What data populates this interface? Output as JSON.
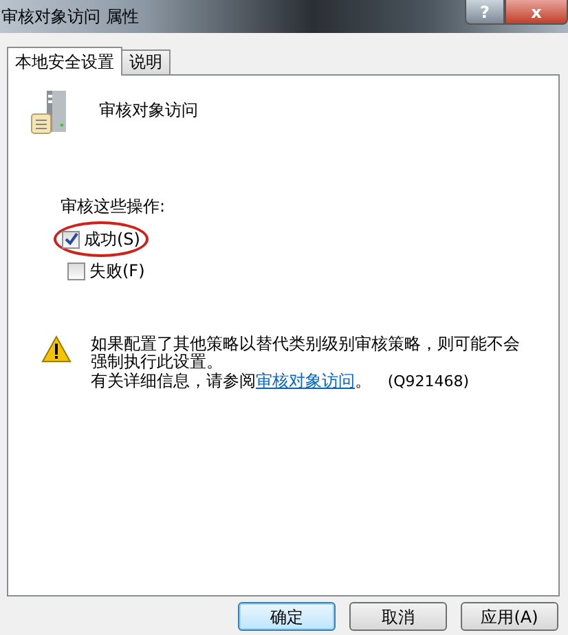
{
  "window": {
    "title": "审核对象访问 属性",
    "help_button": "?",
    "close_button": "x"
  },
  "tabs": [
    {
      "label": "本地安全设置",
      "selected": true
    },
    {
      "label": "说明",
      "selected": false
    }
  ],
  "policy": {
    "name": "审核对象访问"
  },
  "audit": {
    "label": "审核这些操作:",
    "options": [
      {
        "label": "成功(S)",
        "checked": true,
        "highlighted": true
      },
      {
        "label": "失败(F)",
        "checked": false,
        "highlighted": false
      }
    ]
  },
  "warning": {
    "message": "如果配置了其他策略以替代类别级别审核策略，则可能不会强制执行此设置。",
    "more_prefix": "有关详细信息，请参阅",
    "link": "审核对象访问",
    "more_suffix": "。",
    "kb": "(Q921468)"
  },
  "buttons": [
    {
      "label": "确定",
      "default": true
    },
    {
      "label": "取消",
      "default": false
    },
    {
      "label": "应用(A)",
      "default": false
    }
  ]
}
